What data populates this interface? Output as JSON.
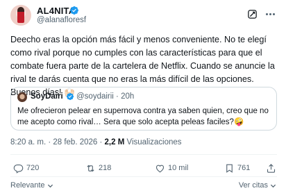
{
  "author": {
    "display_name": "AL4NITA",
    "handle": "@alanafloresf",
    "verified": true
  },
  "tweet": {
    "text": "Deecho eras la opción más fácil y menos conveniente. No te elegí como rival porque no cumples con las características para que el combate fuera parte de la cartelera de Netflix. Cuando se anuncie la rival te darás cuenta que no eras la más difícil de las opciones. Buenos días! 🙌🏻"
  },
  "quoted": {
    "display_name": "SoyDairi",
    "handle_time": "@soydairii · 20h",
    "verified": true,
    "text": "Me ofrecieron pelear en supernova contra ya saben quien, creo que no me acepto como rival… Sera que solo acepta peleas faciles?🤪"
  },
  "meta": {
    "timestamp": "8:20 a. m. · 28 feb. 2026 · ",
    "views_count": "2,2 M",
    "views_label": " Visualizaciones"
  },
  "actions": {
    "replies": "720",
    "retweets": "218",
    "likes": "10 mil",
    "bookmarks": "761"
  },
  "footer": {
    "sort_label": "Relevante",
    "quotes_label": "Ver citas"
  },
  "icons": {
    "verified": "verified-badge-icon",
    "grok": "grok-icon",
    "more": "more-icon",
    "reply": "reply-icon",
    "retweet": "retweet-icon",
    "like": "heart-icon",
    "bookmark": "bookmark-icon",
    "share": "share-icon",
    "chevron": "chevron-down-icon"
  },
  "colors": {
    "verified": "#1d9bf0",
    "text": "#0f1419",
    "secondary": "#536471",
    "border": "#cfd9de"
  }
}
